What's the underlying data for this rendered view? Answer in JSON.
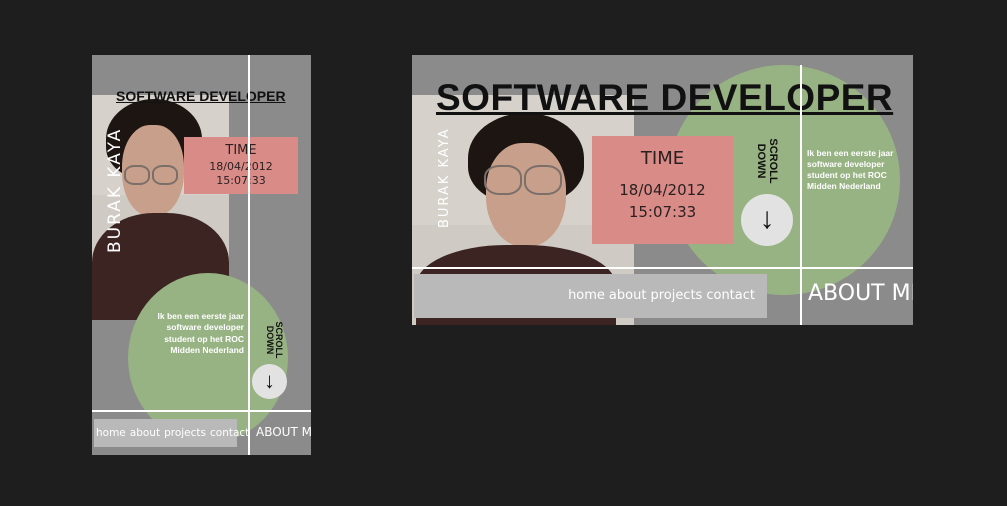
{
  "title": "SOFTWARE DEVELOPER",
  "name": "BURAK KAYA",
  "time_label": "TIME",
  "date": "18/04/2012",
  "clock": "15:07:33",
  "scroll": {
    "line1": "SCROLL",
    "line2": "DOWN"
  },
  "arrow_icon": "arrow-down-icon",
  "arrow_glyph": "↓",
  "bio": "Ik ben een eerste jaar software developer student op het ROC Midden Nederland",
  "nav": {
    "home": "home",
    "about": "about",
    "projects": "projects",
    "contact": "contact"
  },
  "about_me": "ABOUT ME",
  "colors": {
    "background": "#1e1e1e",
    "frame": "#8b8b8b",
    "circle": "#97b383",
    "time_box": "#d98b88",
    "nav_bar": "#b9b9b9"
  }
}
